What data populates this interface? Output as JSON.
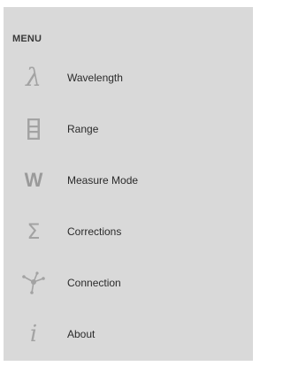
{
  "menu": {
    "header": "MENU",
    "items": [
      {
        "label": "Wavelength",
        "icon": "lambda-icon",
        "glyph": "λ"
      },
      {
        "label": "Range",
        "icon": "range-ladder-icon"
      },
      {
        "label": "Measure Mode",
        "icon": "w-icon",
        "glyph": "W"
      },
      {
        "label": "Corrections",
        "icon": "sigma-icon",
        "glyph": "Σ"
      },
      {
        "label": "Connection",
        "icon": "connection-node-icon"
      },
      {
        "label": "About",
        "icon": "info-icon",
        "glyph": "i"
      }
    ]
  },
  "colors": {
    "panel_background": "#d9d9d9",
    "icon": "#a3a3a3",
    "text": "#2b2b2b"
  }
}
